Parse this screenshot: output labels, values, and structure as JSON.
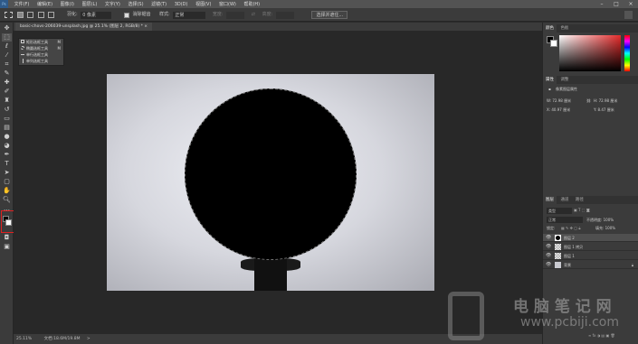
{
  "menu": [
    "文件(F)",
    "编辑(E)",
    "图像(I)",
    "图层(L)",
    "文字(Y)",
    "选择(S)",
    "滤镜(T)",
    "3D(D)",
    "视图(V)",
    "窗口(W)",
    "帮助(H)"
  ],
  "window_controls": [
    "–",
    "□",
    "×"
  ],
  "options": {
    "feather_label": "羽化:",
    "feather_value": "0 像素",
    "antialias_label": "消除锯齿",
    "style_label": "样式:",
    "style_value": "正常",
    "width_label": "宽度:",
    "height_label": "高度:",
    "mask_button": "选择并遮住..."
  },
  "document_tab": "basic-chovs-206039-unsplash.jpg @ 25.1% (图层 2, RGB/8) * ×",
  "flyout": {
    "items": [
      {
        "label": "矩形选框工具",
        "shortcut": "M"
      },
      {
        "label": "椭圆选框工具",
        "shortcut": "M"
      },
      {
        "label": "单行选框工具",
        "shortcut": ""
      },
      {
        "label": "单列选框工具",
        "shortcut": ""
      }
    ]
  },
  "status": {
    "zoom": "25.11%",
    "doc": "文档:18.6M/19.8M"
  },
  "panels": {
    "color_tabs": [
      "颜色",
      "色板"
    ],
    "properties_tabs": [
      "属性",
      "调整"
    ],
    "properties_title": "像素图层属性",
    "properties_fields": [
      "W: 72.98 厘米",
      "H: 72.98 厘米",
      "X: 40.97 厘米",
      "Y: 8.47 厘米"
    ],
    "layers_tabs": [
      "图层",
      "通道",
      "路径"
    ],
    "kind_label": "类型",
    "blend_mode": "正常",
    "opacity": "不透明度: 100%",
    "lock_label": "锁定:",
    "fill": "填充: 100%",
    "layers": [
      {
        "name": "图层 2",
        "selected": true
      },
      {
        "name": "图层 1 拷贝",
        "selected": false
      },
      {
        "name": "图层 1",
        "selected": false
      },
      {
        "name": "背景",
        "selected": false
      }
    ]
  },
  "watermark": {
    "cn": "电 脑 笔 记 网",
    "url": "www.pcbiji.com"
  }
}
